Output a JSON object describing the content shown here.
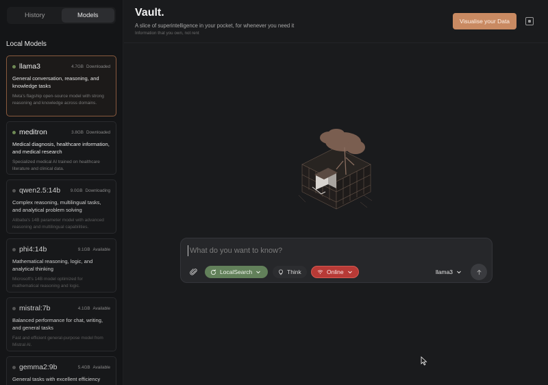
{
  "sidebar": {
    "tabs": [
      {
        "label": "History",
        "active": false
      },
      {
        "label": "Models",
        "active": true
      }
    ],
    "section_title": "Local Models",
    "models": [
      {
        "name": "llama3",
        "size": "4.7GB",
        "status": "Downloaded",
        "description": "General conversation, reasoning, and knowledge tasks",
        "detail": "Meta's flagship open-source model with strong reasoning and knowledge across domains."
      },
      {
        "name": "meditron",
        "size": "3.8GB",
        "status": "Downloaded",
        "description": "Medical diagnosis, healthcare information, and medical research",
        "detail": "Specialized medical AI trained on healthcare literature and clinical data."
      },
      {
        "name": "qwen2.5:14b",
        "size": "9.0GB",
        "status": "Downloading",
        "description": "Complex reasoning, multilingual tasks, and analytical problem solving",
        "detail": "Alibaba's 14B parameter model with advanced reasoning and multilingual capabilities."
      },
      {
        "name": "phi4:14b",
        "size": "9.1GB",
        "status": "Available",
        "description": "Mathematical reasoning, logic, and analytical thinking",
        "detail": "Microsoft's 14B model optimized for mathematical reasoning and logic."
      },
      {
        "name": "mistral:7b",
        "size": "4.1GB",
        "status": "Available",
        "description": "Balanced performance for chat, writing, and general tasks",
        "detail": "Fast and efficient general-purpose model from Mistral AI."
      },
      {
        "name": "gemma2:9b",
        "size": "5.4GB",
        "status": "Available",
        "description": "General tasks with excellent efficiency",
        "detail": ""
      }
    ]
  },
  "header": {
    "title": "Vault.",
    "subtitle": "A slice of superintelligence in your pocket, for whenever you need it",
    "tagline": "Information that you own, not rent",
    "visualise_label": "Visualise your Data"
  },
  "prompt": {
    "placeholder": "What do you want to know?",
    "search_label": "LocalSearch",
    "think_label": "Think",
    "online_label": "Online",
    "selected_model": "llama3"
  },
  "colors": {
    "accent": "#c98a62",
    "search_pill": "#62805a",
    "online_pill": "#b73a36",
    "status_dot": "#6f8a55"
  }
}
